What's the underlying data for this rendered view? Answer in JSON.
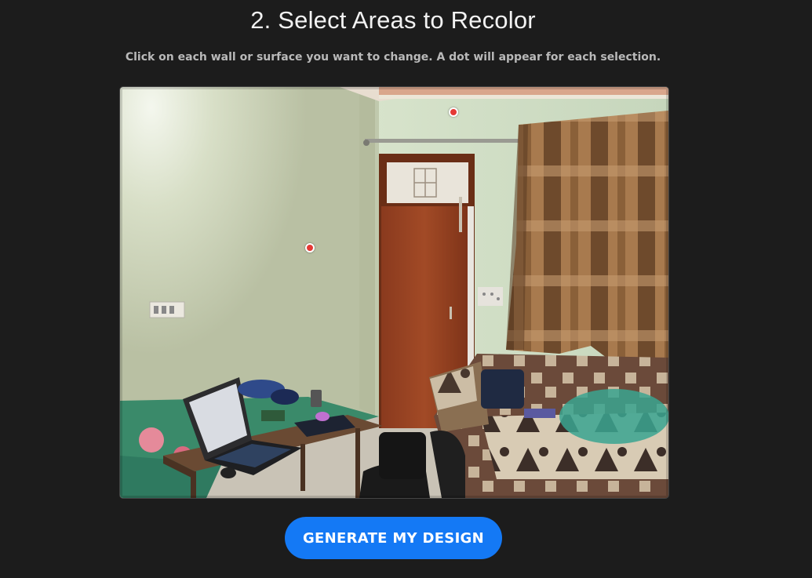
{
  "header": {
    "title": "2. Select Areas to Recolor",
    "instructions": "Click on each wall or surface you want to change. A dot will appear for each selection."
  },
  "image": {
    "selections": [
      {
        "label": "selection-1"
      },
      {
        "label": "selection-2"
      }
    ]
  },
  "actions": {
    "generate_label": "GENERATE MY DESIGN"
  },
  "colors": {
    "background": "#1c1c1c",
    "accent": "#1479f5",
    "dot": "#e53935"
  }
}
